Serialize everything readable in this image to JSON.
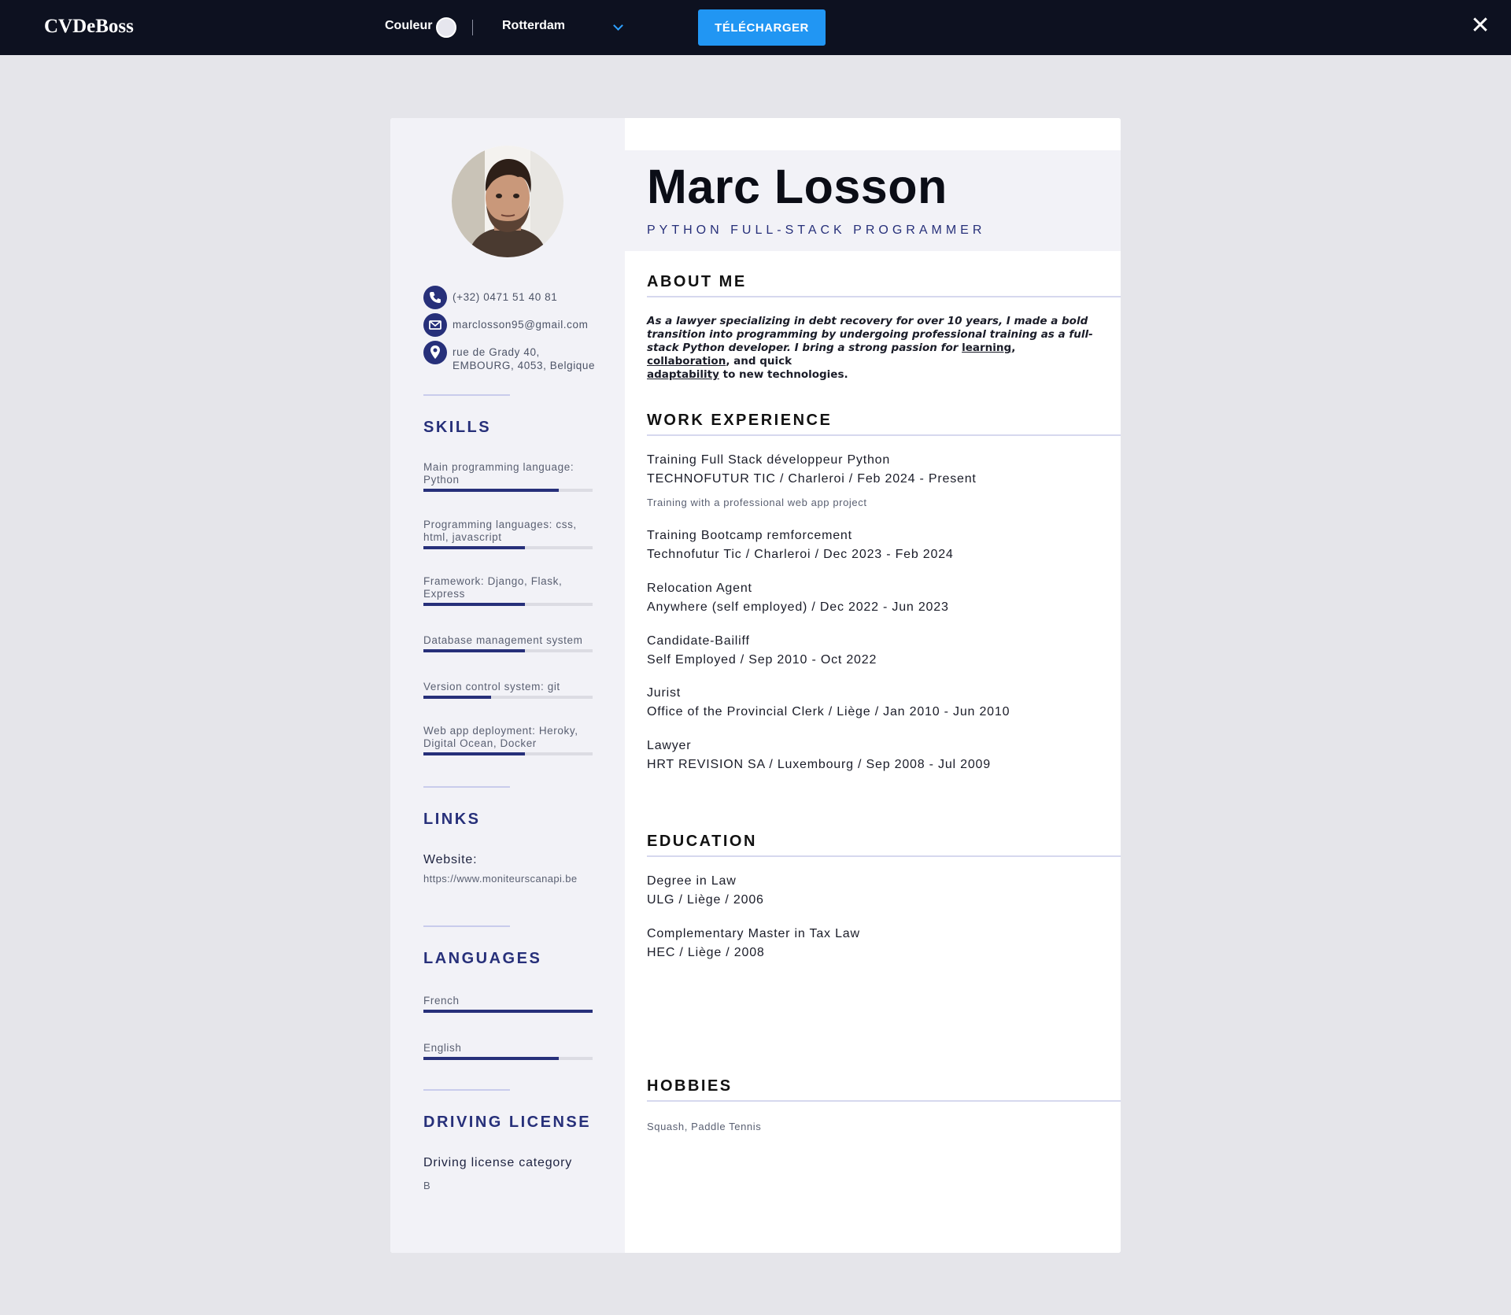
{
  "app": {
    "brand": "CVDeBoss",
    "color_label": "Couleur",
    "template": "Rotterdam",
    "download_label": "TÉLÉCHARGER",
    "close_symbol": "✕",
    "accent": "#2196f3",
    "cv_color": "#27307a"
  },
  "cv": {
    "name": "Marc Losson",
    "title": "PYTHON FULL-STACK PROGRAMMER",
    "contact": {
      "phone": "(+32) 0471 51 40 81",
      "email": "marclosson95@gmail.com",
      "address_line1": "rue de Grady 40,",
      "address_line2": "EMBOURG, 4053, Belgique",
      "icons": [
        "phone-icon",
        "email-icon",
        "location-pin-icon"
      ]
    },
    "skills_title": "SKILLS",
    "skills": [
      {
        "label": "Main programming language: Python",
        "level": 0.8
      },
      {
        "label": "Programming languages: css, html, javascript",
        "level": 0.6
      },
      {
        "label": "Framework: Django, Flask, Express",
        "level": 0.6
      },
      {
        "label": "Database management system",
        "level": 0.6
      },
      {
        "label": "Version control system: git",
        "level": 0.4
      },
      {
        "label": "Web app deployment: Heroky, Digital Ocean, Docker",
        "level": 0.6
      }
    ],
    "links_title": "LINKS",
    "website_label": "Website:",
    "website_url": "https://www.moniteurscanapi.be",
    "languages_title": "LANGUAGES",
    "languages": [
      {
        "label": "French",
        "level": 1.0
      },
      {
        "label": "English",
        "level": 0.8
      }
    ],
    "driving_title": "DRIVING LICENSE",
    "driving_label": "Driving license category",
    "driving_value": "B",
    "about_title": "ABOUT ME",
    "about": {
      "part1": "As a lawyer specializing in debt recovery for over 10 years, I made a bold transition into programming by undergoing professional training as a full-stack Python developer. I bring a strong passion for ",
      "learning": "learning",
      "comma1": ", ",
      "collaboration": "collaboration",
      "part2": ", and quick",
      "adaptability": "adaptability",
      "part3": " to new technologies."
    },
    "work_title": "WORK EXPERIENCE",
    "work": [
      {
        "role": "Training Full Stack développeur Python",
        "detail": "TECHNOFUTUR TIC / Charleroi / Feb 2024 - Present",
        "desc": "Training with a professional web app project"
      },
      {
        "role": "Training Bootcamp remforcement",
        "detail": "Technofutur Tic / Charleroi / Dec 2023 - Feb 2024"
      },
      {
        "role": "Relocation Agent",
        "detail": "Anywhere (self employed) / Dec 2022 - Jun 2023"
      },
      {
        "role": "Candidate-Bailiff",
        "detail": "Self Employed / Sep 2010 - Oct 2022"
      },
      {
        "role": "Jurist",
        "detail": "Office of the Provincial Clerk / Liège / Jan 2010 - Jun 2010"
      },
      {
        "role": "Lawyer",
        "detail": "HRT REVISION SA / Luxembourg / Sep 2008 - Jul 2009"
      }
    ],
    "education_title": "EDUCATION",
    "education": [
      {
        "degree": "Degree in Law",
        "detail": "ULG / Liège / 2006"
      },
      {
        "degree": "Complementary Master in Tax Law",
        "detail": "HEC / Liège / 2008"
      }
    ],
    "hobbies_title": "HOBBIES",
    "hobbies": "Squash, Paddle Tennis"
  }
}
